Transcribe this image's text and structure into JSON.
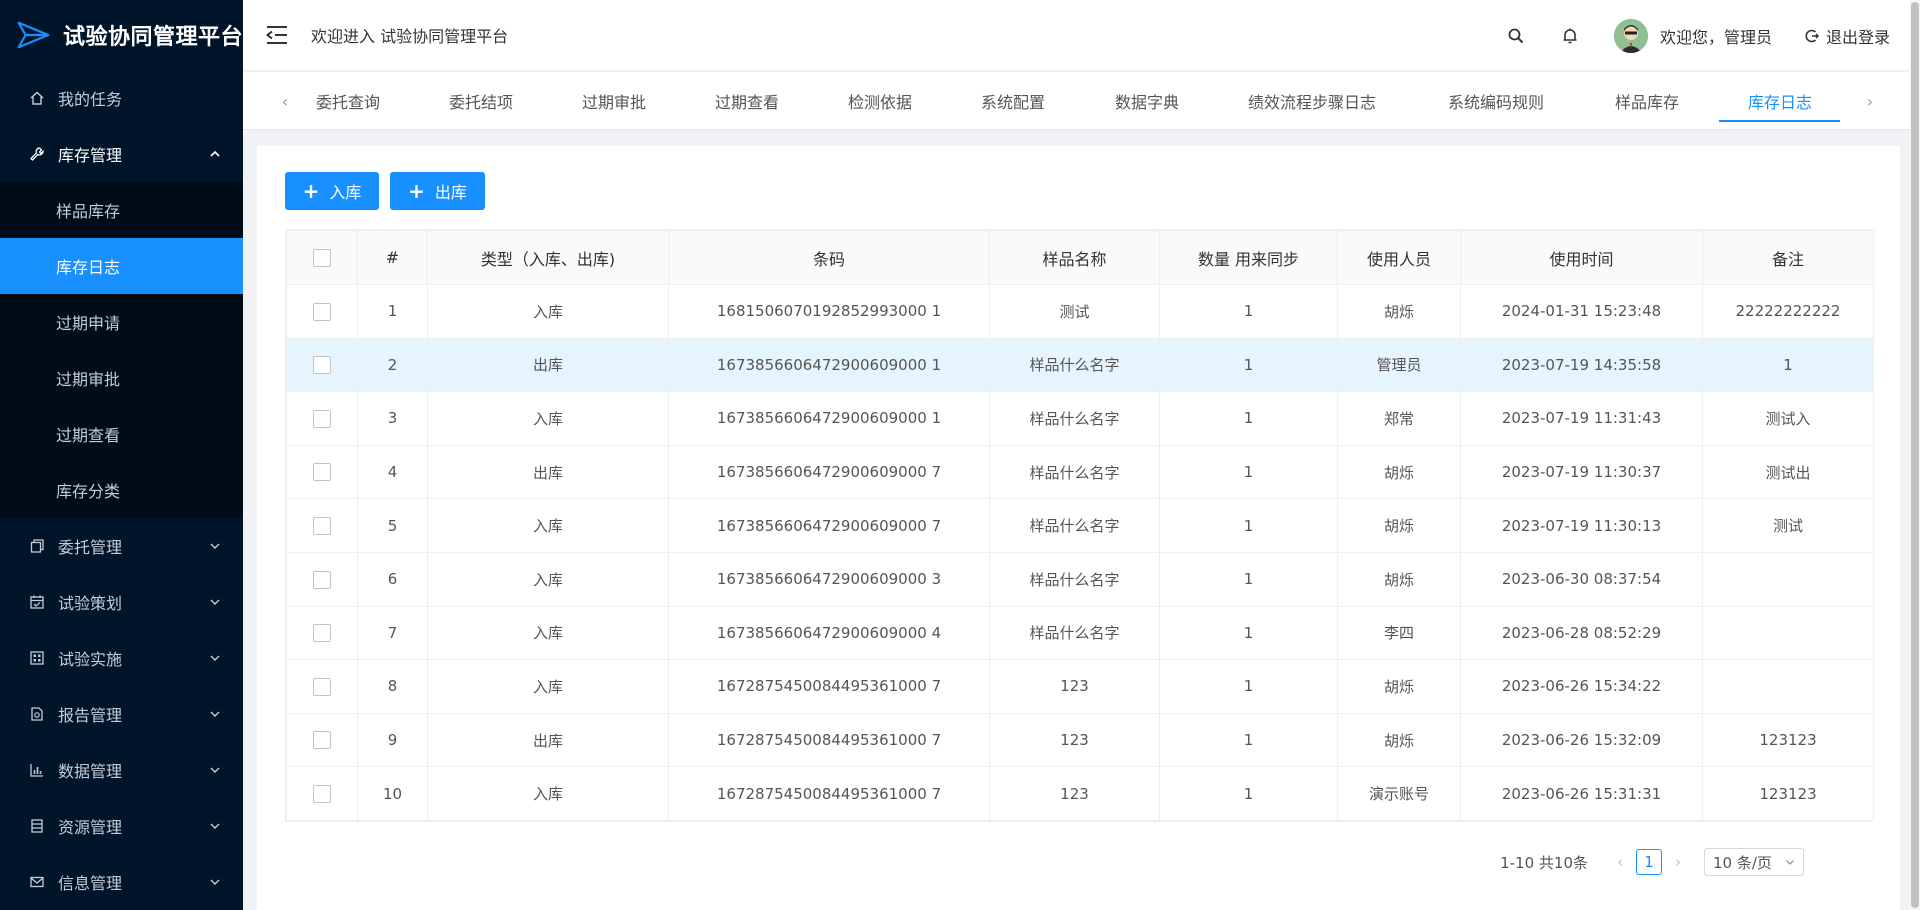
{
  "app": {
    "title": "试验协同管理平台"
  },
  "sidebar": {
    "items": [
      {
        "label": "我的任务",
        "icon": "home-icon"
      },
      {
        "label": "库存管理",
        "icon": "wrench-icon",
        "open": true,
        "children": [
          {
            "label": "样品库存"
          },
          {
            "label": "库存日志",
            "active": true
          },
          {
            "label": "过期申请"
          },
          {
            "label": "过期审批"
          },
          {
            "label": "过期查看"
          },
          {
            "label": "库存分类"
          }
        ]
      },
      {
        "label": "委托管理",
        "icon": "copy-icon"
      },
      {
        "label": "试验策划",
        "icon": "calendar-icon"
      },
      {
        "label": "试验实施",
        "icon": "grid-icon"
      },
      {
        "label": "报告管理",
        "icon": "report-icon"
      },
      {
        "label": "数据管理",
        "icon": "bar-chart-icon"
      },
      {
        "label": "资源管理",
        "icon": "database-icon"
      },
      {
        "label": "信息管理",
        "icon": "mail-icon"
      }
    ]
  },
  "header": {
    "welcome": "欢迎进入 试验协同管理平台",
    "greeting": "欢迎您，管理员",
    "logout": "退出登录"
  },
  "tabs": [
    {
      "label": "委托查询"
    },
    {
      "label": "委托结项"
    },
    {
      "label": "过期审批"
    },
    {
      "label": "过期查看"
    },
    {
      "label": "检测依据"
    },
    {
      "label": "系统配置"
    },
    {
      "label": "数据字典"
    },
    {
      "label": "绩效流程步骤日志"
    },
    {
      "label": "系统编码规则"
    },
    {
      "label": "样品库存"
    },
    {
      "label": "库存日志",
      "active": true
    }
  ],
  "toolbar": {
    "in_label": "入库",
    "out_label": "出库"
  },
  "table": {
    "headers": [
      "#",
      "类型（入库、出库)",
      "条码",
      "样品名称",
      "数量 用来同步",
      "使用人员",
      "使用时间",
      "备注"
    ],
    "rows": [
      [
        "1",
        "入库",
        "1681506070192852993000 1",
        "测试",
        "1",
        "胡烁",
        "2024-01-31 15:23:48",
        "22222222222"
      ],
      [
        "2",
        "出库",
        "1673856606472900609000 1",
        "样品什么名字",
        "1",
        "管理员",
        "2023-07-19 14:35:58",
        "1"
      ],
      [
        "3",
        "入库",
        "1673856606472900609000 1",
        "样品什么名字",
        "1",
        "郑常",
        "2023-07-19 11:31:43",
        "测试入"
      ],
      [
        "4",
        "出库",
        "1673856606472900609000 7",
        "样品什么名字",
        "1",
        "胡烁",
        "2023-07-19 11:30:37",
        "测试出"
      ],
      [
        "5",
        "入库",
        "1673856606472900609000 7",
        "样品什么名字",
        "1",
        "胡烁",
        "2023-07-19 11:30:13",
        "测试"
      ],
      [
        "6",
        "入库",
        "1673856606472900609000 3",
        "样品什么名字",
        "1",
        "胡烁",
        "2023-06-30 08:37:54",
        ""
      ],
      [
        "7",
        "入库",
        "1673856606472900609000 4",
        "样品什么名字",
        "1",
        "李四",
        "2023-06-28 08:52:29",
        ""
      ],
      [
        "8",
        "入库",
        "1672875450084495361000 7",
        "123",
        "1",
        "胡烁",
        "2023-06-26 15:34:22",
        ""
      ],
      [
        "9",
        "出库",
        "1672875450084495361000 7",
        "123",
        "1",
        "胡烁",
        "2023-06-26 15:32:09",
        "123123"
      ],
      [
        "10",
        "入库",
        "1672875450084495361000 7",
        "123",
        "1",
        "演示账号",
        "2023-06-26 15:31:31",
        "123123"
      ]
    ],
    "highlighted_row": 2
  },
  "pagination": {
    "total_text": "1-10 共10条",
    "current_page": "1",
    "page_size": "10 条/页"
  },
  "colors": {
    "primary": "#1890ff",
    "sidebar_bg": "#001529",
    "submenu_bg": "#000c17"
  }
}
